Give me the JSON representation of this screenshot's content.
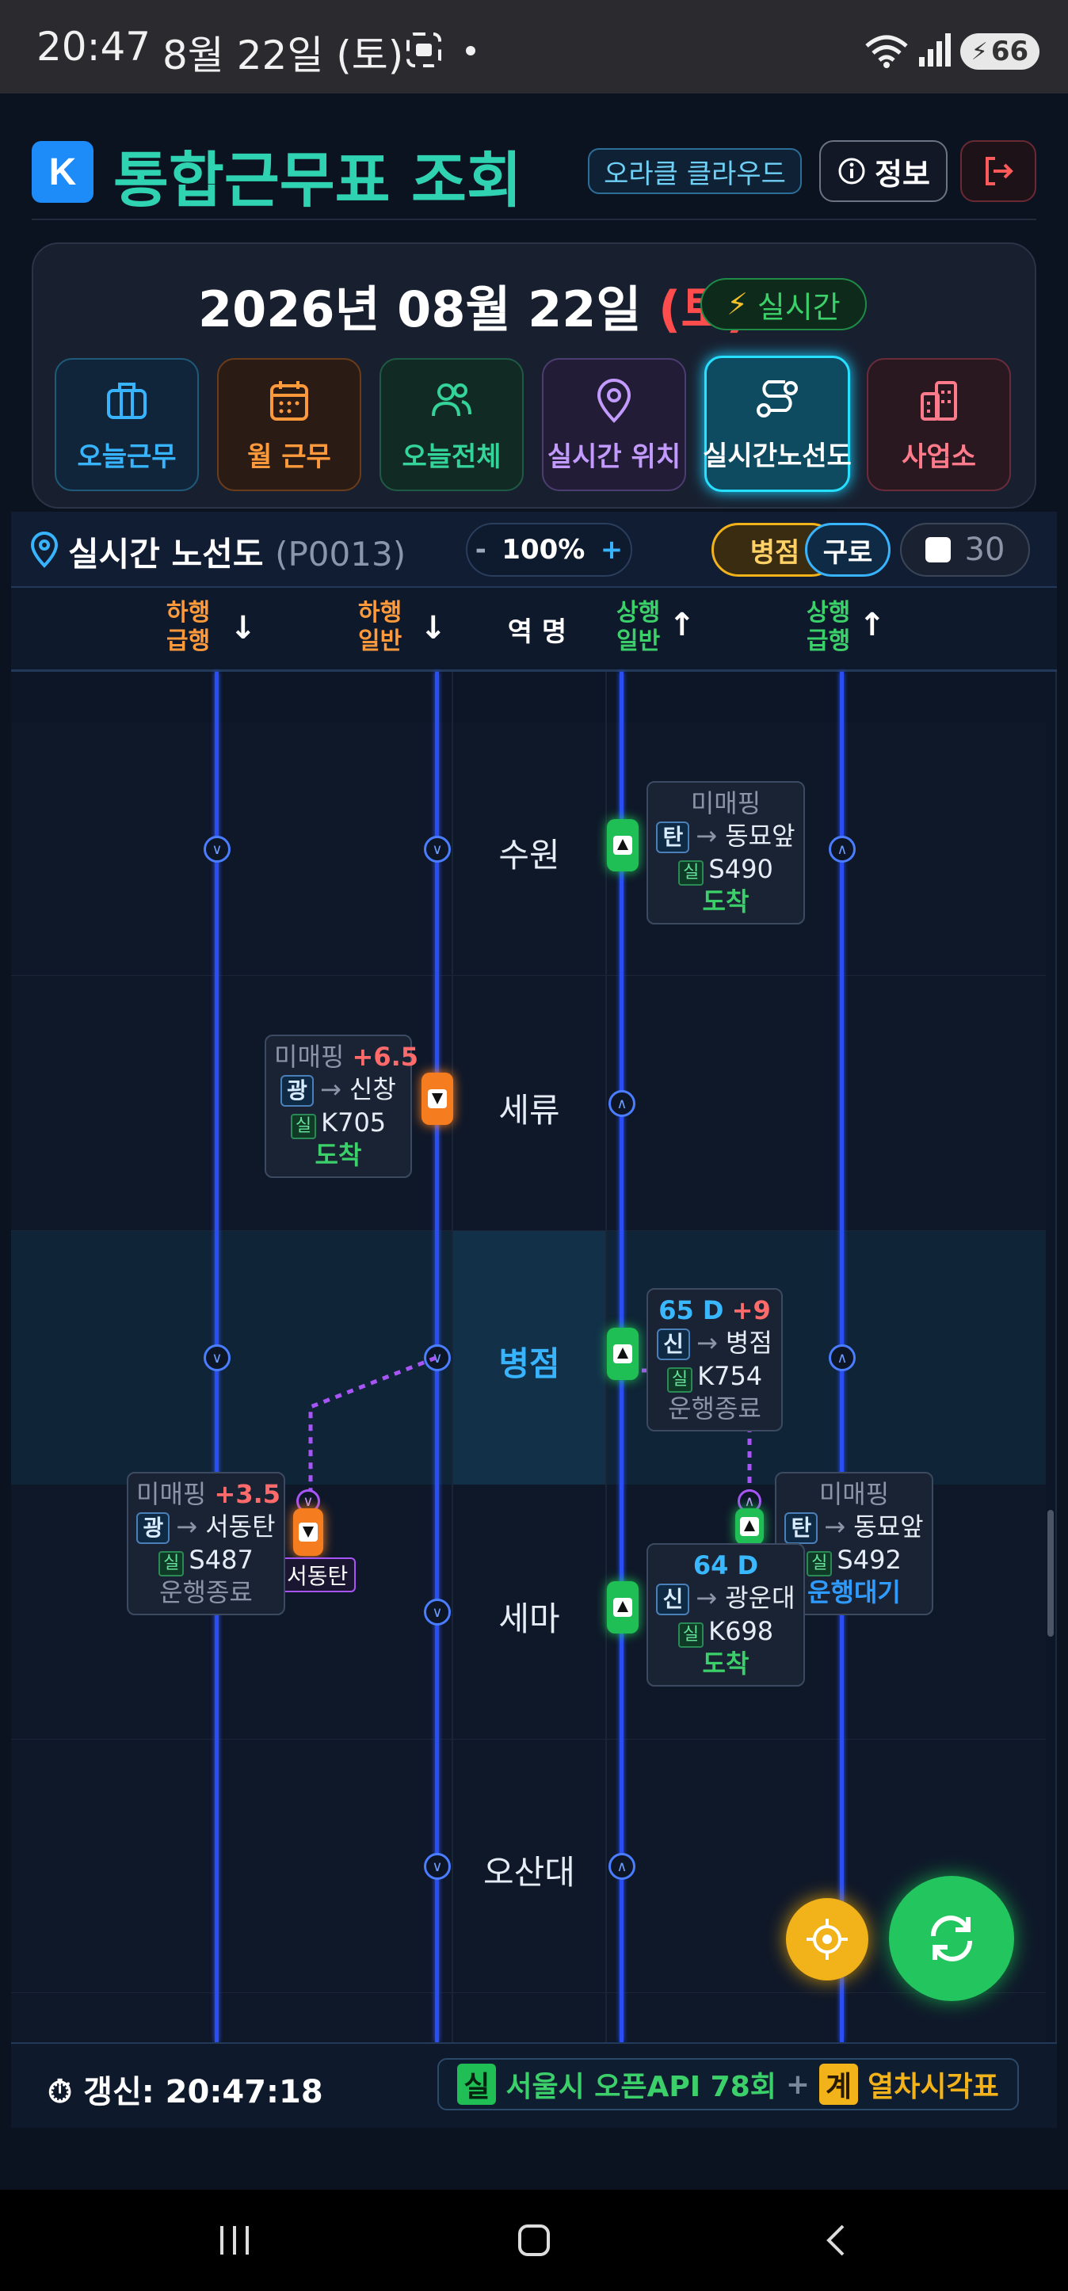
{
  "status_bar": {
    "time": "20:47",
    "date": "8월 22일 (토)",
    "battery": "66"
  },
  "header": {
    "logo": "K",
    "title": "통합근무표 조회",
    "cloud_label": "오라클 클라우드",
    "info_label": "정보"
  },
  "date_card": {
    "date": "2026년 08월 22일 ",
    "dow": "(토)",
    "realtime_label": "실시간"
  },
  "nav": [
    {
      "label": "오늘근무",
      "icon": "briefcase-icon",
      "color": "#38b4ff"
    },
    {
      "label": "월 근무",
      "icon": "calendar-icon",
      "color": "#ff9a3c"
    },
    {
      "label": "오늘전체",
      "icon": "users-icon",
      "color": "#34d399"
    },
    {
      "label": "실시간 위치",
      "icon": "map-pin-icon",
      "color": "#c39bff"
    },
    {
      "label": "실시간노선도",
      "icon": "route-icon",
      "color": "#ffffff"
    },
    {
      "label": "사업소",
      "icon": "building-icon",
      "color": "#ff7a8a"
    }
  ],
  "panel": {
    "title": "실시간 노선도",
    "code": "(P0013)",
    "zoom": "100%",
    "zoom_minus": "-",
    "zoom_plus": "+",
    "filter1": "병점",
    "filter2": "구로",
    "count": "30"
  },
  "columns": {
    "down_express": [
      "하행",
      "급행"
    ],
    "down_local": [
      "하행",
      "일반"
    ],
    "station": "역 명",
    "up_local": [
      "상행",
      "일반"
    ],
    "up_express": [
      "상행",
      "급행"
    ]
  },
  "stations": [
    "수원",
    "세류",
    "병점",
    "세마",
    "오산대"
  ],
  "trains": {
    "t1": {
      "status": "미매핑",
      "line": "탄",
      "dest": "동묘앞",
      "badge": "실",
      "no": "S490",
      "state": "도착"
    },
    "t2": {
      "status": "미매핑",
      "delay": "+6.5",
      "line": "광",
      "dest": "신창",
      "badge": "실",
      "no": "K705",
      "state": "도착"
    },
    "t3": {
      "code": "65 D",
      "delay": "+9",
      "line": "신",
      "dest": "병점",
      "badge": "실",
      "no": "K754",
      "state": "운행종료"
    },
    "t4": {
      "status": "미매핑",
      "delay": "+3.5",
      "line": "광",
      "dest": "서동탄",
      "badge": "실",
      "no": "S487",
      "state": "운행종료",
      "branch": "서동탄"
    },
    "t5": {
      "status": "미매핑",
      "line": "탄",
      "dest": "동묘앞",
      "badge": "실",
      "no": "S492",
      "state": "운행대기"
    },
    "t6": {
      "code": "64 D",
      "line": "신",
      "dest": "광운대",
      "badge": "실",
      "no": "K698",
      "state": "도착"
    }
  },
  "footer": {
    "refresh": "갱신: 20:47:18",
    "src1_tag": "실",
    "src1": "서울시 오픈API 78회",
    "plus": "+",
    "src2_tag": "계",
    "src2": "열차시각표"
  }
}
